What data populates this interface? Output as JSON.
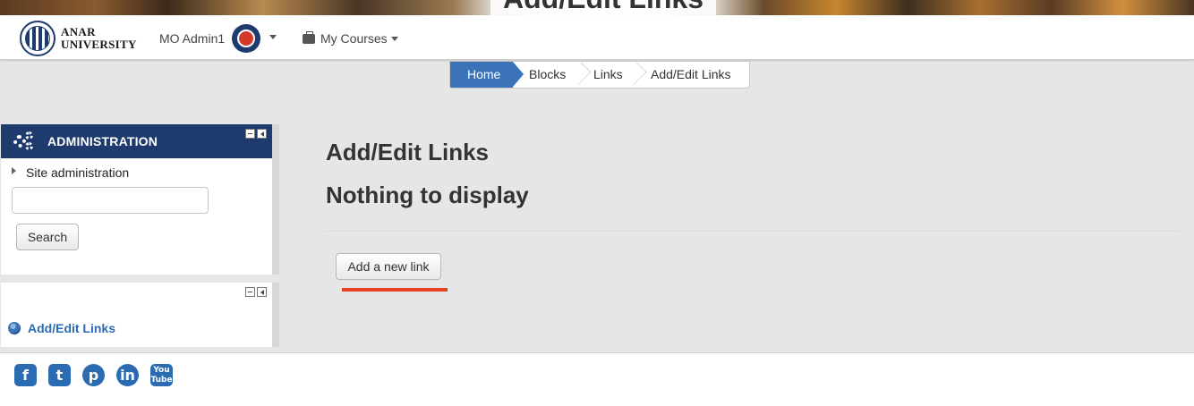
{
  "banner": {
    "title": "Add/Edit Links"
  },
  "navbar": {
    "logo_line1": "ANAR",
    "logo_line2": "UNIVERSITY",
    "user_name": "MO Admin1",
    "courses_label": "My Courses"
  },
  "breadcrumb": [
    "Home",
    "Blocks",
    "Links",
    "Add/Edit Links"
  ],
  "admin_block": {
    "title": "ADMINISTRATION",
    "tree_item": "Site administration",
    "search_value": "",
    "search_button": "Search"
  },
  "links_block": {
    "item": "Add/Edit Links"
  },
  "main": {
    "title": "Add/Edit Links",
    "empty_message": "Nothing to display",
    "add_button": "Add a new link"
  },
  "footer": {
    "social": [
      {
        "icon": "facebook-icon",
        "glyph": "f"
      },
      {
        "icon": "twitter-icon",
        "glyph": "t"
      },
      {
        "icon": "pinterest-icon",
        "glyph": "p"
      },
      {
        "icon": "linkedin-icon",
        "glyph": "in"
      },
      {
        "icon": "youtube-icon",
        "glyph": "You Tube"
      }
    ]
  },
  "colors": {
    "brand_navy": "#1f3b6e",
    "breadcrumb_home": "#3b73b9",
    "link_blue": "#2a6bb2",
    "highlight_underline": "#e5431f"
  }
}
